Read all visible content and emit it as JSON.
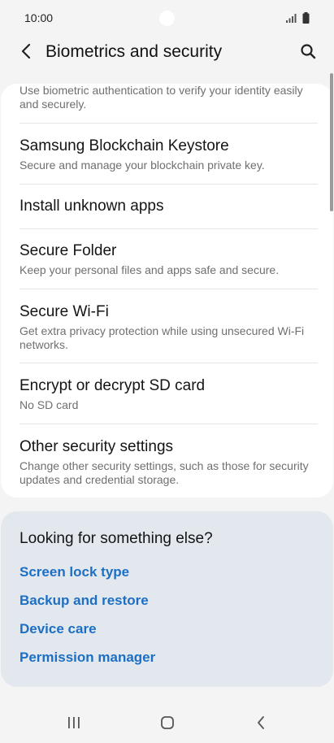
{
  "status_bar": {
    "time": "10:00",
    "icons": [
      "signal-icon",
      "battery-icon"
    ]
  },
  "app_bar": {
    "title": "Biometrics and security",
    "back_icon": "chevron-left-icon",
    "search_icon": "search-icon"
  },
  "settings": {
    "partial_item_desc": "Use biometric authentication to verify your identity easily and securely.",
    "items": [
      {
        "title": "Samsung Blockchain Keystore",
        "desc": "Secure and manage your blockchain private key."
      },
      {
        "title": "Install unknown apps",
        "desc": ""
      },
      {
        "title": "Secure Folder",
        "desc": "Keep your personal files and apps safe and secure."
      },
      {
        "title": "Secure Wi-Fi",
        "desc": "Get extra privacy protection while using unsecured Wi-Fi networks."
      },
      {
        "title": "Encrypt or decrypt SD card",
        "desc": "No SD card"
      },
      {
        "title": "Other security settings",
        "desc": "Change other security settings, such as those for security updates and credential storage."
      }
    ]
  },
  "suggestions": {
    "title": "Looking for something else?",
    "links": [
      "Screen lock type",
      "Backup and restore",
      "Device care",
      "Permission manager"
    ]
  },
  "nav_bar": {
    "icons": [
      "recent-apps-icon",
      "home-icon",
      "back-icon"
    ]
  },
  "colors": {
    "background": "#f4f4f4",
    "card": "#ffffff",
    "suggest_card": "#e3e8ee",
    "link": "#1d6fc4"
  }
}
